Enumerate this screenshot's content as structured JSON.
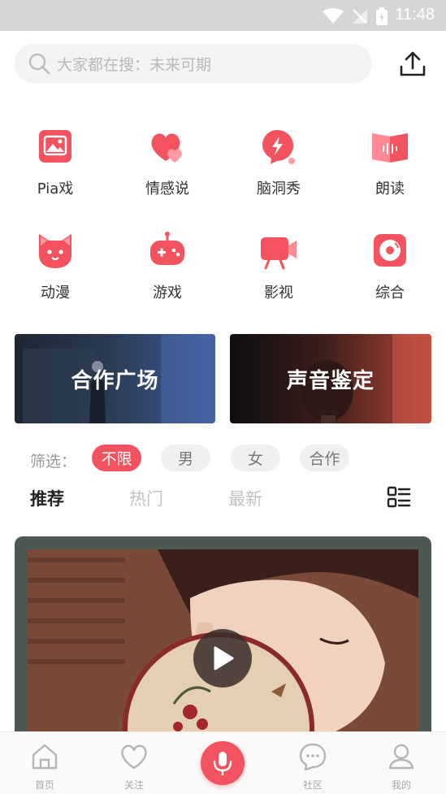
{
  "status_bar": {
    "time": "11:48"
  },
  "search": {
    "placeholder": "大家都在搜：未来可期"
  },
  "categories": [
    {
      "label": "Pia戏",
      "icon": "picture-icon"
    },
    {
      "label": "情感说",
      "icon": "hearts-icon"
    },
    {
      "label": "脑洞秀",
      "icon": "lightning-bubble-icon"
    },
    {
      "label": "朗读",
      "icon": "book-wave-icon"
    },
    {
      "label": "动漫",
      "icon": "cat-face-icon"
    },
    {
      "label": "游戏",
      "icon": "gamepad-icon"
    },
    {
      "label": "影视",
      "icon": "video-camera-icon"
    },
    {
      "label": "综合",
      "icon": "record-disc-icon"
    }
  ],
  "banners": [
    {
      "title": "合作广场"
    },
    {
      "title": "声音鉴定"
    }
  ],
  "filter": {
    "label": "筛选：",
    "options": [
      "不限",
      "男",
      "女",
      "合作"
    ],
    "selected": "不限"
  },
  "tabs": {
    "items": [
      "推荐",
      "热门",
      "最新"
    ],
    "active": "推荐"
  },
  "bottom_nav": {
    "items": [
      {
        "label": "首页",
        "icon": "home-icon"
      },
      {
        "label": "关注",
        "icon": "heart-icon"
      },
      {
        "label": "",
        "icon": "microphone-icon"
      },
      {
        "label": "社区",
        "icon": "chat-bubble-icon"
      },
      {
        "label": "我的",
        "icon": "user-icon"
      }
    ]
  },
  "colors": {
    "accent": "#f2535e",
    "chip_bg": "#f0f0f0",
    "muted_text": "#c2c2c2"
  }
}
